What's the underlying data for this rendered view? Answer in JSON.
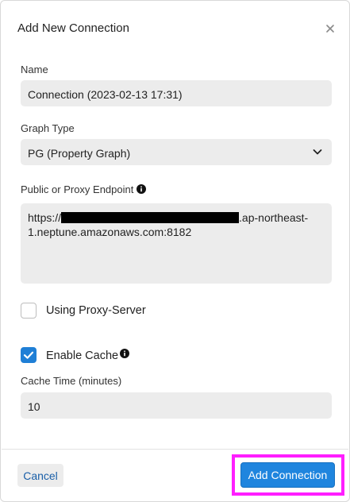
{
  "dialog": {
    "title": "Add New Connection",
    "close_icon": "close-icon"
  },
  "form": {
    "name_label": "Name",
    "name_value": "Connection (2023-02-13 17:31)",
    "graph_type_label": "Graph Type",
    "graph_type_value": "PG (Property Graph)",
    "endpoint_label": "Public or Proxy Endpoint",
    "endpoint_prefix": "https://",
    "endpoint_suffix": ".ap-northeast-",
    "endpoint_line2": "1.neptune.amazonaws.com:8182",
    "proxy_label": "Using Proxy-Server",
    "proxy_checked": false,
    "cache_label": "Enable Cache",
    "cache_checked": true,
    "cache_time_label": "Cache Time (minutes)",
    "cache_time_value": "10"
  },
  "footer": {
    "cancel_label": "Cancel",
    "add_label": "Add Connection"
  },
  "colors": {
    "accent": "#1f85de",
    "highlight": "#ff1eff",
    "field_bg": "#ececec"
  }
}
